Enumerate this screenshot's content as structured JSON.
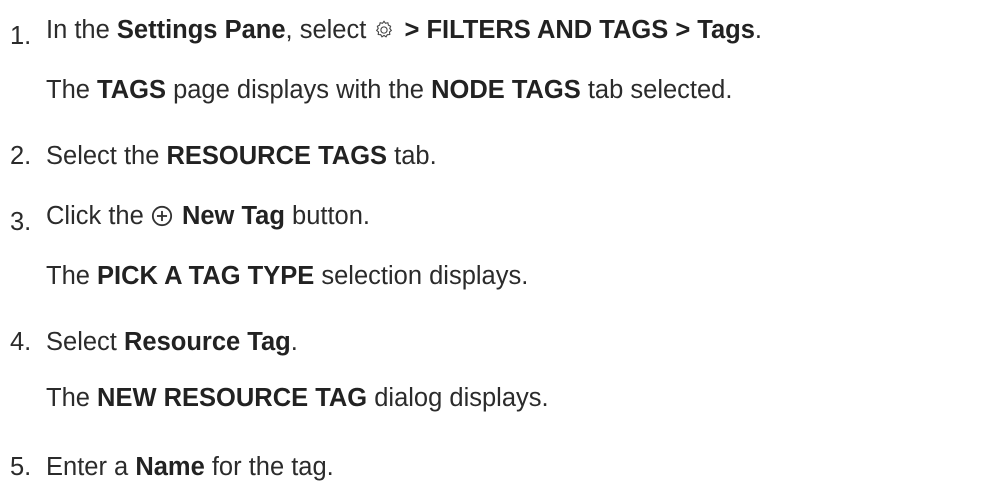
{
  "steps": [
    {
      "number": "1.",
      "line": {
        "t1": "In the ",
        "b1": "Settings Pane",
        "t2": ", select ",
        "icon": "gear-icon",
        "b2": " > FILTERS AND TAGS > Tags",
        "t3": "."
      },
      "sub": {
        "t1": "The ",
        "b1": "TAGS",
        "t2": " page displays with the ",
        "b2": "NODE TAGS",
        "t3": " tab selected."
      }
    },
    {
      "number": "2.",
      "line": {
        "t1": "Select the ",
        "b1": "RESOURCE TAGS",
        "t2": " tab."
      }
    },
    {
      "number": "3.",
      "line": {
        "t1": "Click the ",
        "icon": "plus-circle-icon",
        "b1": " New Tag",
        "t2": " button."
      },
      "sub": {
        "t1": "The ",
        "b1": "PICK A TAG TYPE",
        "t2": " selection displays."
      }
    },
    {
      "number": "4.",
      "line": {
        "t1": "Select ",
        "b1": "Resource Tag",
        "t2": "."
      },
      "sub": {
        "t1": "The ",
        "b1": "NEW RESOURCE TAG",
        "t2": " dialog displays."
      }
    },
    {
      "number": "5.",
      "line": {
        "t1": "Enter a ",
        "b1": "Name",
        "t2": " for the tag."
      }
    }
  ],
  "colors": {
    "text": "#2b2b2b",
    "icon": "#444444"
  }
}
